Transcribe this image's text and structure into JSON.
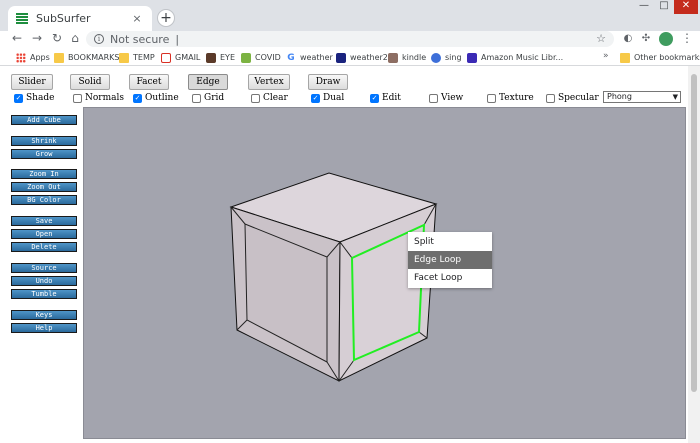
{
  "browser": {
    "tab_title": "SubSurfer",
    "tab_close": "×",
    "new_tab": "+",
    "win_min": "—",
    "win_max": "□",
    "win_close": "✕",
    "back": "←",
    "forward": "→",
    "reload": "↻",
    "home": "⌂",
    "security_text": "Not secure",
    "url_separator": "|",
    "star": "☆",
    "menu": "⋮",
    "bookmarks": [
      {
        "label": "Apps",
        "icon": "apps-icon"
      },
      {
        "label": "BOOKMARKS",
        "icon": "folder-icon"
      },
      {
        "label": "TEMP",
        "icon": "folder-icon"
      },
      {
        "label": "GMAIL",
        "icon": "gmail-icon"
      },
      {
        "label": "EYE",
        "icon": "eye-icon"
      },
      {
        "label": "COVID",
        "icon": "covid-icon"
      },
      {
        "label": "weather",
        "icon": "google-icon"
      },
      {
        "label": "weather2",
        "icon": "weather-icon"
      },
      {
        "label": "kindle",
        "icon": "kindle-icon"
      },
      {
        "label": "sing",
        "icon": "sing-icon"
      },
      {
        "label": "Amazon Music Libr...",
        "icon": "music-icon"
      }
    ],
    "bookmarks_more": "»",
    "other_bookmarks": "Other bookmarks",
    "google_letter": "G"
  },
  "app": {
    "modes": [
      "Slider",
      "Solid",
      "Facet",
      "Edge",
      "Vertex",
      "Draw"
    ],
    "active_mode": "Edge",
    "options": [
      {
        "label": "Shade",
        "checked": true
      },
      {
        "label": "Normals",
        "checked": false
      },
      {
        "label": "Outline",
        "checked": true
      },
      {
        "label": "Grid",
        "checked": false
      },
      {
        "label": "Clear",
        "checked": false
      },
      {
        "label": "Dual",
        "checked": true
      },
      {
        "label": "Edit",
        "checked": true
      },
      {
        "label": "View",
        "checked": false
      },
      {
        "label": "Texture",
        "checked": false
      },
      {
        "label": "Specular",
        "checked": false
      }
    ],
    "shading_select": "Phong",
    "sidebar": [
      "Add Cube",
      "Shrink",
      "Grow",
      "Zoom In",
      "Zoom Out",
      "BG Color",
      "Save",
      "Open",
      "Delete",
      "Source",
      "Undo",
      "Tumble",
      "Keys",
      "Help"
    ],
    "context_menu": [
      "Split",
      "Edge Loop",
      "Facet Loop"
    ],
    "context_menu_highlighted": "Edge Loop",
    "colors": {
      "viewport_bg": "#a3a4ae",
      "cube_face": "#d8d0d6",
      "selected_edge_loop": "#22ee22",
      "sidebar_button": "#3a7fb5"
    }
  }
}
